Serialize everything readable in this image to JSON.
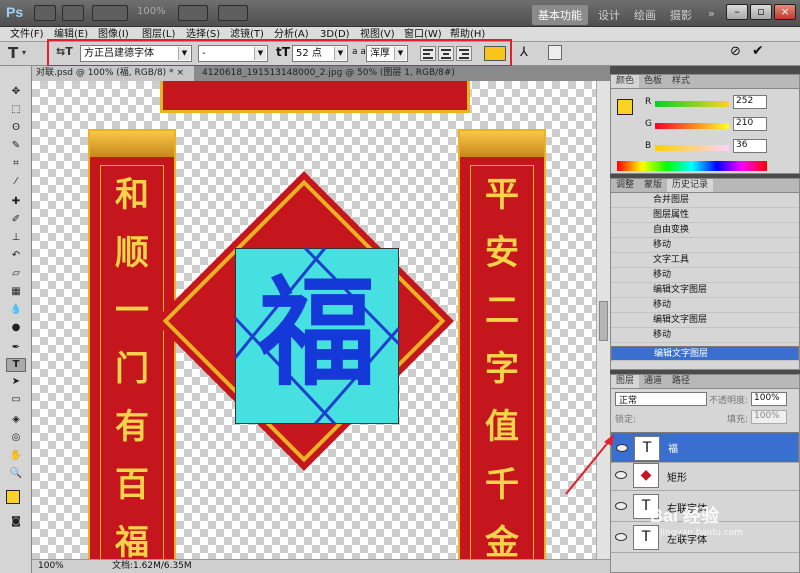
{
  "app": {
    "logo": "Ps",
    "zoom": "100%"
  },
  "workspaces": [
    "基本功能",
    "设计",
    "绘画",
    "摄影"
  ],
  "workspace_more": "»",
  "menu": [
    "文件(F)",
    "编辑(E)",
    "图像(I)",
    "图层(L)",
    "选择(S)",
    "滤镜(T)",
    "分析(A)",
    "3D(D)",
    "视图(V)",
    "窗口(W)",
    "帮助(H)"
  ],
  "options": {
    "font_family": "方正吕建德字体",
    "font_style": "-",
    "font_size": "52 点",
    "aa_label": "a a",
    "antialias": "浑厚",
    "text_color": "#f7c51a"
  },
  "doc_tabs": [
    {
      "label": "对联.psd @ 100% (福, RGB/8) *",
      "close": "×"
    },
    {
      "label": "4120618_191513148000_2.jpg @ 50% (图层 1, RGB/8#) *",
      "close": "×"
    }
  ],
  "canvas": {
    "fu": "福",
    "left_couplet": [
      "和",
      "顺",
      "一",
      "门",
      "有",
      "百",
      "福"
    ],
    "right_couplet": [
      "平",
      "安",
      "二",
      "字",
      "值",
      "千",
      "金"
    ]
  },
  "status": {
    "zoom": "100%",
    "doc": "文档:1.62M/6.35M"
  },
  "color_panel": {
    "tabs": [
      "颜色",
      "色板",
      "样式"
    ],
    "r_label": "R",
    "g_label": "G",
    "b_label": "B",
    "r": "252",
    "g": "210",
    "b": "36",
    "swatch": "#fcd224"
  },
  "history_panel": {
    "tabs": [
      "调整",
      "蒙版",
      "历史记录"
    ],
    "items": [
      "合并图层",
      "图层属性",
      "自由变换",
      "移动",
      "文字工具",
      "移动",
      "编辑文字图层",
      "移动",
      "编辑文字图层",
      "移动",
      "编辑文字图层"
    ],
    "selected": 10
  },
  "layers_panel": {
    "tabs": [
      "图层",
      "通道",
      "路径"
    ],
    "blend_mode": "正常",
    "opacity_label": "不透明度:",
    "opacity": "100%",
    "lock_label": "锁定:",
    "fill_label": "填充:",
    "fill": "100%",
    "layers": [
      {
        "name": "福",
        "type": "T",
        "selected": true
      },
      {
        "name": "矩形",
        "type": "◆",
        "selected": false
      },
      {
        "name": "右联字体",
        "type": "T",
        "selected": false
      },
      {
        "name": "左联字体",
        "type": "T",
        "selected": false
      }
    ]
  },
  "watermark": "Bai 经验",
  "watermark_url": "jingyan.baidu.com"
}
